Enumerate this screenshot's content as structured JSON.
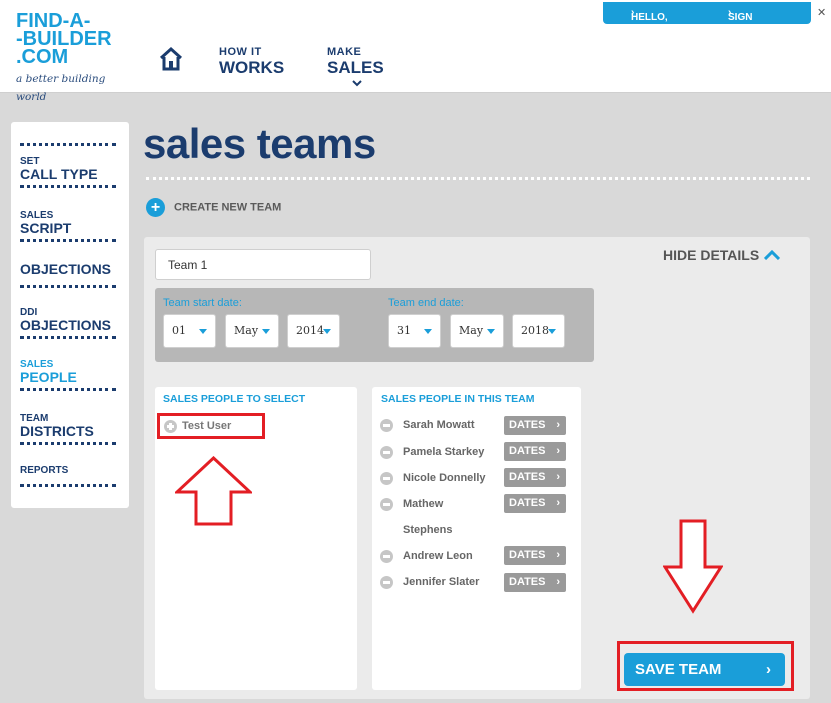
{
  "header": {
    "logo_lines": [
      "FIND-A-",
      "-BUILDER",
      ".COM"
    ],
    "logo_tagline": "a better building world",
    "nav": [
      {
        "small": "HOW IT",
        "big": "WORKS"
      },
      {
        "small": "MAKE",
        "big": "SALES"
      }
    ],
    "user_greeting": "HELLO, TEST",
    "sign_out": "SIGN OUT",
    "close_glyph": "✕",
    "icons": {
      "home": "home-icon",
      "chevron": "chevron-down-icon"
    }
  },
  "sidebar": {
    "items": [
      {
        "small": "SET",
        "big": "CALL TYPE",
        "active": false
      },
      {
        "small": "SALES",
        "big": "SCRIPT",
        "active": false
      },
      {
        "small": "",
        "big": "OBJECTIONS",
        "active": false
      },
      {
        "small": "DDI",
        "big": "OBJECTIONS",
        "active": false
      },
      {
        "small": "SALES",
        "big": "PEOPLE",
        "active": true
      },
      {
        "small": "TEAM",
        "big": "DISTRICTS",
        "active": false
      },
      {
        "small": "REPORTS",
        "big": "",
        "active": false
      }
    ]
  },
  "main": {
    "title": "sales teams",
    "create_team": "CREATE NEW TEAM",
    "team_name": "Team 1",
    "hide_details": "HIDE DETAILS",
    "start_label": "Team start date:",
    "end_label": "Team end date:",
    "start_date": {
      "day": "01",
      "month": "May",
      "year": "2014"
    },
    "end_date": {
      "day": "31",
      "month": "May",
      "year": "2018"
    },
    "select_title": "SALES PEOPLE TO SELECT",
    "in_team_title": "SALES PEOPLE IN THIS TEAM",
    "available_people": [
      "Test User"
    ],
    "team_members": [
      "Sarah Mowatt",
      "Pamela Starkey",
      "Nicole Donnelly",
      "Mathew",
      "Stephens",
      "Andrew Leon",
      "Jennifer Slater"
    ],
    "dates_label": "DATES",
    "save_label": "SAVE TEAM"
  },
  "colors": {
    "brand_blue": "#1a9ed9",
    "navy": "#1b3c6e",
    "annotation_red": "#e31e24"
  }
}
